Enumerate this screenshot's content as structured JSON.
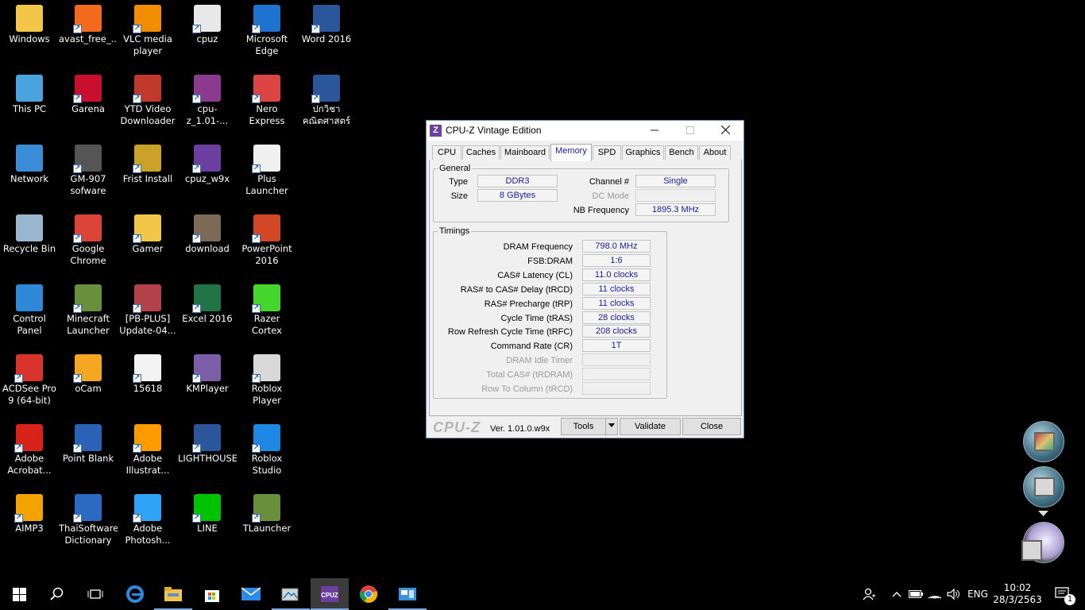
{
  "desktop": {
    "icons": [
      {
        "label": "Windows",
        "glyph": "folder-icon",
        "color": "#f3c64a"
      },
      {
        "label": "avast_free_...",
        "glyph": "avast-icon",
        "color": "#f26b1d"
      },
      {
        "label": "VLC media\nplayer",
        "glyph": "vlc-icon",
        "color": "#f28c00"
      },
      {
        "label": "cpuz",
        "glyph": "file-icon",
        "color": "#e8e8e8"
      },
      {
        "label": "Microsoft\nEdge",
        "glyph": "edge-icon",
        "color": "#1e73d0"
      },
      {
        "label": "Word 2016",
        "glyph": "word-icon",
        "color": "#2b579a"
      },
      {
        "label": "This PC",
        "glyph": "computer-icon",
        "color": "#4aa3df"
      },
      {
        "label": "Garena",
        "glyph": "garena-icon",
        "color": "#c8102e"
      },
      {
        "label": "YTD Video\nDownloader",
        "glyph": "ytd-icon",
        "color": "#c0392b"
      },
      {
        "label": "cpu-z_1.01-...",
        "glyph": "winrar-icon",
        "color": "#8b3a8f"
      },
      {
        "label": "Nero Express",
        "glyph": "nero-icon",
        "color": "#d44"
      },
      {
        "label": "ปกวิชา\nคณิตศาสตร์",
        "glyph": "word-doc-icon",
        "color": "#2b579a"
      },
      {
        "label": "Network",
        "glyph": "network-icon",
        "color": "#3c8dd8"
      },
      {
        "label": "GM-907\nsofware",
        "glyph": "mouse-icon",
        "color": "#555"
      },
      {
        "label": "Frist Install",
        "glyph": "installer-icon",
        "color": "#c9a227"
      },
      {
        "label": "cpuz_w9x",
        "glyph": "cpuz-icon",
        "color": "#6b3fa0"
      },
      {
        "label": "Plus\nLauncher",
        "glyph": "file-icon",
        "color": "#f0f0f0"
      },
      {
        "label": "",
        "glyph": "",
        "color": ""
      },
      {
        "label": "Recycle Bin",
        "glyph": "recycle-bin-icon",
        "color": "#9bb7cf"
      },
      {
        "label": "Google\nChrome",
        "glyph": "chrome-icon",
        "color": "#db4437"
      },
      {
        "label": "Gamer",
        "glyph": "folder-icon",
        "color": "#f3c64a"
      },
      {
        "label": "download",
        "glyph": "image-icon",
        "color": "#7b6a55"
      },
      {
        "label": "PowerPoint\n2016",
        "glyph": "powerpoint-icon",
        "color": "#d24726"
      },
      {
        "label": "",
        "glyph": "",
        "color": ""
      },
      {
        "label": "Control\nPanel",
        "glyph": "control-panel-icon",
        "color": "#2f87d8"
      },
      {
        "label": "Minecraft\nLauncher",
        "glyph": "minecraft-icon",
        "color": "#6a8f3c"
      },
      {
        "label": "[PB-PLUS]\nUpdate-04...",
        "glyph": "archive-icon",
        "color": "#b4424a"
      },
      {
        "label": "Excel 2016",
        "glyph": "excel-icon",
        "color": "#217346"
      },
      {
        "label": "Razer Cortex",
        "glyph": "razer-icon",
        "color": "#44d62c"
      },
      {
        "label": "",
        "glyph": "",
        "color": ""
      },
      {
        "label": "ACDSee Pro\n9 (64-bit)",
        "glyph": "acdsee-icon",
        "color": "#d9342b"
      },
      {
        "label": "oCam",
        "glyph": "ocam-icon",
        "color": "#f5a623"
      },
      {
        "label": "15618",
        "glyph": "image-icon",
        "color": "#f3f3f3"
      },
      {
        "label": "KMPlayer",
        "glyph": "kmplayer-icon",
        "color": "#7b5ea7"
      },
      {
        "label": "Roblox Player",
        "glyph": "roblox-icon",
        "color": "#d9d9d9"
      },
      {
        "label": "",
        "glyph": "",
        "color": ""
      },
      {
        "label": "Adobe\nAcrobat...",
        "glyph": "acrobat-icon",
        "color": "#d8231b"
      },
      {
        "label": "Point Blank",
        "glyph": "pointblank-icon",
        "color": "#2a62b8"
      },
      {
        "label": "Adobe\nIllustrat...",
        "glyph": "illustrator-icon",
        "color": "#ff9a00"
      },
      {
        "label": "LIGHTHOUSE",
        "glyph": "word-doc-icon",
        "color": "#2b579a"
      },
      {
        "label": "Roblox\nStudio",
        "glyph": "roblox-studio-icon",
        "color": "#1e88e5"
      },
      {
        "label": "",
        "glyph": "",
        "color": ""
      },
      {
        "label": "AIMP3",
        "glyph": "aimp-icon",
        "color": "#f4a300"
      },
      {
        "label": "ThaiSoftware\nDictionary",
        "glyph": "globe-icon",
        "color": "#2b6ac2"
      },
      {
        "label": "Adobe\nPhotosh...",
        "glyph": "photoshop-icon",
        "color": "#2fa3f7"
      },
      {
        "label": "LINE",
        "glyph": "line-icon",
        "color": "#00c300"
      },
      {
        "label": "TLauncher",
        "glyph": "tlauncher-icon",
        "color": "#6a8f3c"
      },
      {
        "label": "",
        "glyph": "",
        "color": ""
      }
    ]
  },
  "cpuz": {
    "title": "CPU-Z Vintage Edition",
    "app_icon_text": "Z",
    "tabs": [
      "CPU",
      "Caches",
      "Mainboard",
      "Memory",
      "SPD",
      "Graphics",
      "Bench",
      "About"
    ],
    "active_tab": "Memory",
    "general": {
      "legend": "General",
      "type_label": "Type",
      "type_value": "DDR3",
      "size_label": "Size",
      "size_value": "8 GBytes",
      "channel_label": "Channel #",
      "channel_value": "Single",
      "dc_mode_label": "DC Mode",
      "dc_mode_value": "",
      "nb_freq_label": "NB Frequency",
      "nb_freq_value": "1895.3 MHz"
    },
    "timings": {
      "legend": "Timings",
      "rows": [
        {
          "label": "DRAM Frequency",
          "value": "798.0 MHz"
        },
        {
          "label": "FSB:DRAM",
          "value": "1:6"
        },
        {
          "label": "CAS# Latency (CL)",
          "value": "11.0 clocks"
        },
        {
          "label": "RAS# to CAS# Delay (tRCD)",
          "value": "11 clocks"
        },
        {
          "label": "RAS# Precharge (tRP)",
          "value": "11 clocks"
        },
        {
          "label": "Cycle Time (tRAS)",
          "value": "28 clocks"
        },
        {
          "label": "Row Refresh Cycle Time (tRFC)",
          "value": "208 clocks"
        },
        {
          "label": "Command Rate (CR)",
          "value": "1T"
        },
        {
          "label": "DRAM Idle Timer",
          "value": ""
        },
        {
          "label": "Total CAS# (tRDRAM)",
          "value": ""
        },
        {
          "label": "Row To Column (tRCD)",
          "value": ""
        }
      ]
    },
    "brand": "CPU-Z",
    "version": "Ver. 1.01.0.w9x",
    "tools_label": "Tools",
    "validate_label": "Validate",
    "close_label": "Close"
  },
  "taskbar": {
    "language": "ENG",
    "time": "10:02",
    "date": "28/3/2563",
    "notification_count": "1",
    "accent_color": "#7aa7d8"
  }
}
